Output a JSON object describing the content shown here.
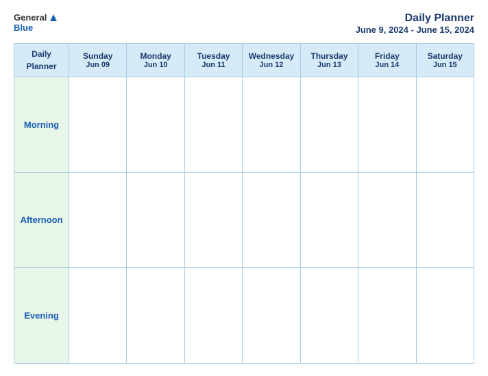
{
  "header": {
    "logo_general": "General",
    "logo_blue": "Blue",
    "planner_title": "Daily Planner",
    "date_range": "June 9, 2024 - June 15, 2024"
  },
  "table": {
    "corner_label_line1": "Daily",
    "corner_label_line2": "Planner",
    "columns": [
      {
        "day": "Sunday",
        "date": "Jun 09"
      },
      {
        "day": "Monday",
        "date": "Jun 10"
      },
      {
        "day": "Tuesday",
        "date": "Jun 11"
      },
      {
        "day": "Wednesday",
        "date": "Jun 12"
      },
      {
        "day": "Thursday",
        "date": "Jun 13"
      },
      {
        "day": "Friday",
        "date": "Jun 14"
      },
      {
        "day": "Saturday",
        "date": "Jun 15"
      }
    ],
    "rows": [
      {
        "label": "Morning"
      },
      {
        "label": "Afternoon"
      },
      {
        "label": "Evening"
      }
    ]
  }
}
